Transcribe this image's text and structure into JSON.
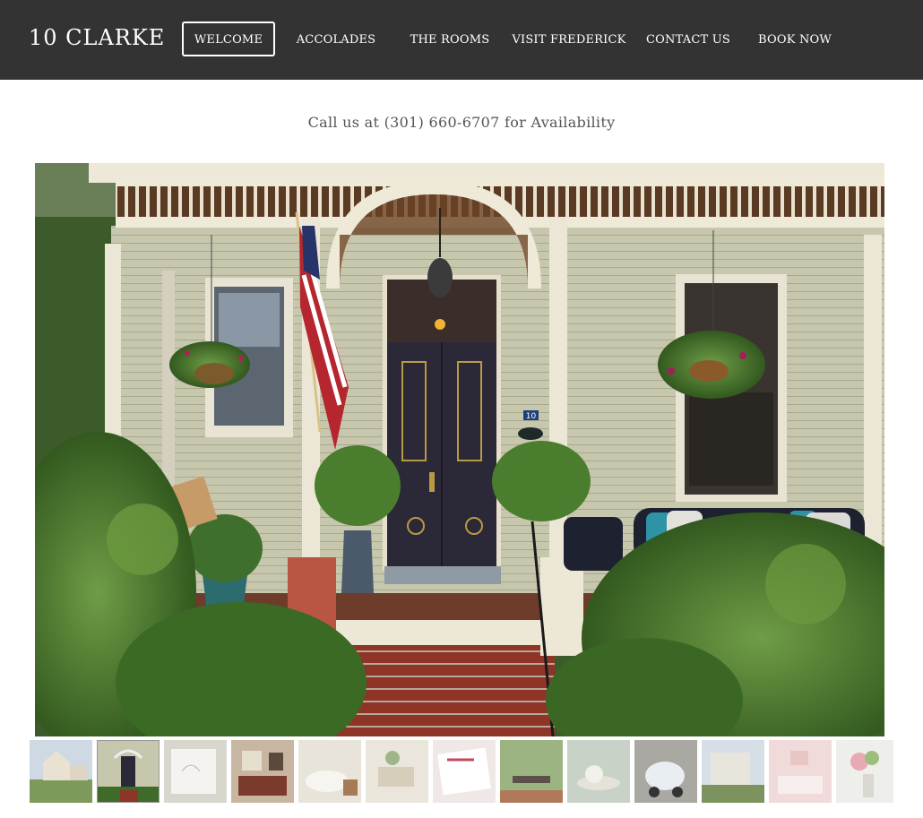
{
  "header": {
    "logo": "10 CLARKE",
    "nav": [
      {
        "label": "WELCOME",
        "active": true
      },
      {
        "label": "ACCOLADES",
        "active": false
      },
      {
        "label": "THE ROOMS",
        "active": false
      },
      {
        "label": "VISIT FREDERICK",
        "active": false
      },
      {
        "label": "CONTACT US",
        "active": false
      },
      {
        "label": "BOOK NOW",
        "active": false
      }
    ]
  },
  "main": {
    "callout": "Call us at (301) 660-6707 for Availability",
    "hero": {
      "house_number": "10"
    }
  },
  "gallery": {
    "thumbnails": [
      {
        "subject": "house-exterior",
        "active": false
      },
      {
        "subject": "front-porch",
        "active": true
      },
      {
        "subject": "linens",
        "active": false
      },
      {
        "subject": "bedroom",
        "active": false
      },
      {
        "subject": "bathtub",
        "active": false
      },
      {
        "subject": "sitting-room",
        "active": false
      },
      {
        "subject": "book",
        "active": false
      },
      {
        "subject": "garden-table",
        "active": false
      },
      {
        "subject": "tea-set",
        "active": false
      },
      {
        "subject": "scooter",
        "active": false
      },
      {
        "subject": "porch-exterior",
        "active": false
      },
      {
        "subject": "pink-bedroom",
        "active": false
      },
      {
        "subject": "flowers",
        "active": false
      }
    ]
  },
  "colors": {
    "header_bg": "#333333",
    "text": "#555555",
    "siding": "#c9c9b1",
    "trim": "#eeeadc",
    "door": "#2c2838",
    "brick": "#9a3b2f",
    "foliage": "#4f7d34"
  }
}
